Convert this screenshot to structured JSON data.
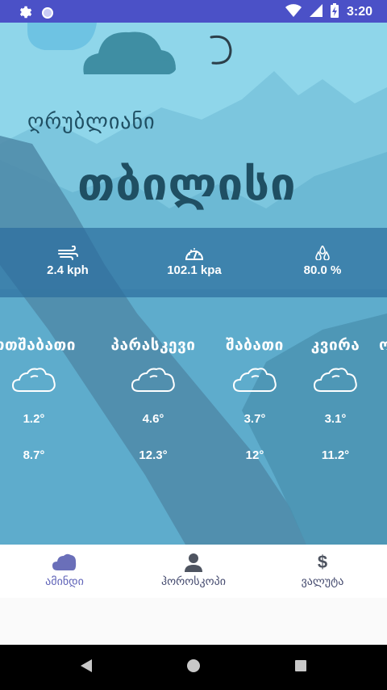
{
  "status_bar": {
    "time": "3:20",
    "icons": [
      "gear-icon",
      "circle-icon",
      "wifi-icon",
      "signal-icon",
      "battery-charging-icon"
    ]
  },
  "weather": {
    "greeting": "ღრუბლიანი",
    "city": "თბილისი",
    "stats": {
      "wind": "2.4 kph",
      "pressure": "102.1 kpa",
      "humidity": "80.0 %"
    },
    "forecast": [
      {
        "day": "ოთშაბათი",
        "icon": "cloud-icon",
        "min": "1.2°",
        "max": "8.7°"
      },
      {
        "day": "პარასკევი",
        "icon": "cloud-icon",
        "min": "4.6°",
        "max": "12.3°"
      },
      {
        "day": "შაბათი",
        "icon": "cloud-icon",
        "min": "3.7°",
        "max": "12°"
      },
      {
        "day": "კვირა",
        "icon": "cloud-icon",
        "min": "3.1°",
        "max": "11.2°"
      },
      {
        "day": "ო",
        "icon": "cloud-icon",
        "min": "",
        "max": ""
      }
    ]
  },
  "bottom_nav": {
    "items": [
      {
        "label": "ამინდი",
        "icon": "cloud-icon",
        "active": true
      },
      {
        "label": "ჰოროსკოპი",
        "icon": "person-icon",
        "active": false
      },
      {
        "label": "ვალუტა",
        "icon": "dollar-icon",
        "active": false
      }
    ]
  },
  "colors": {
    "status_bar": "#4b51c7",
    "sky": "#8fd6ea",
    "text_dark": "#1f4f63",
    "nav_active": "#5f63b8"
  }
}
